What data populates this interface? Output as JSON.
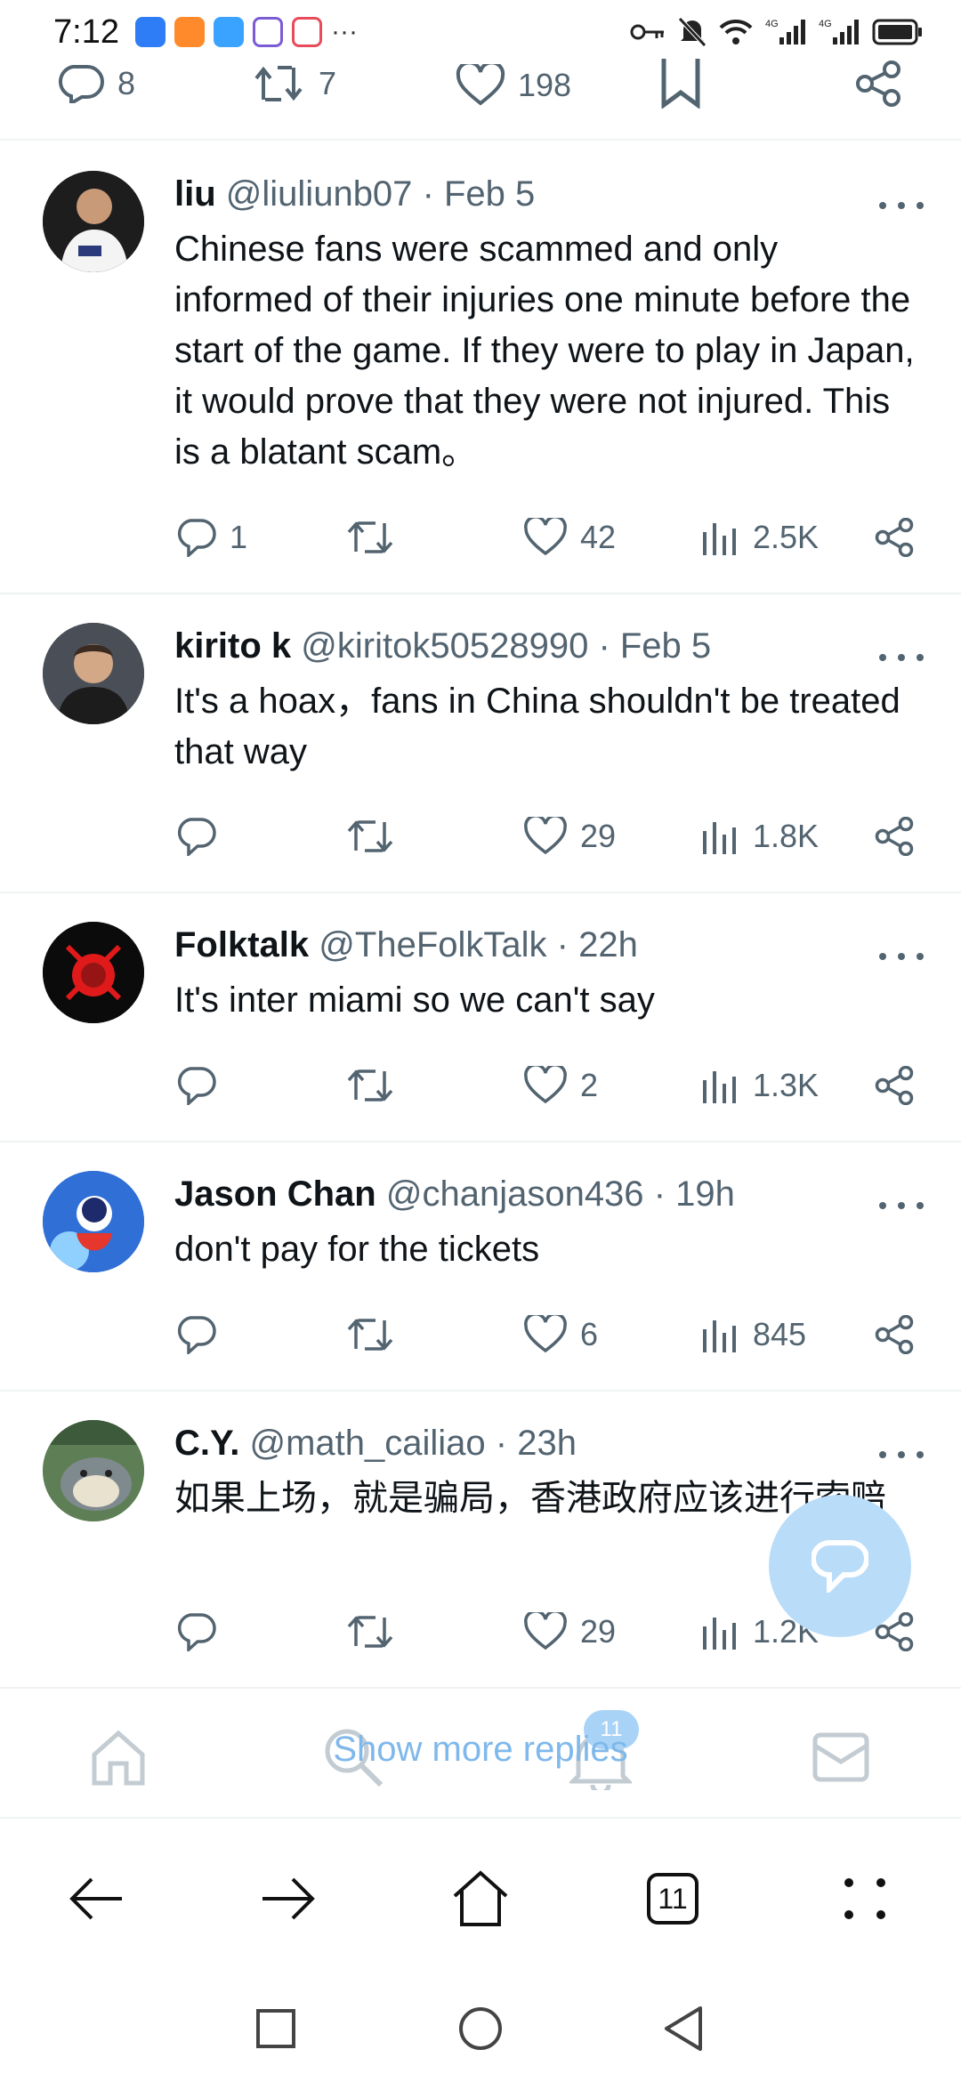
{
  "status_bar": {
    "time": "7:12",
    "more_indicator": "···"
  },
  "top_actions": {
    "replies": "8",
    "reposts": "7",
    "likes": "198"
  },
  "tweets": [
    {
      "name": "liu",
      "handle": "@liuliunb07",
      "time": "· Feb 5",
      "text": "Chinese fans were scammed and only informed of their injuries one minute before the start of the game. If they were to play in Japan, it would prove that they were not injured. This is a blatant scam。",
      "replies": "1",
      "reposts": "",
      "likes": "42",
      "views": "2.5K"
    },
    {
      "name": "kirito k",
      "handle": "@kiritok50528990",
      "time": "· Feb 5",
      "text": "It's a hoax，fans in China shouldn't be treated that way",
      "replies": "",
      "reposts": "",
      "likes": "29",
      "views": "1.8K"
    },
    {
      "name": "Folktalk",
      "handle": "@TheFolkTalk",
      "time": "· 22h",
      "text": "It's inter miami so we can't say",
      "replies": "",
      "reposts": "",
      "likes": "2",
      "views": "1.3K"
    },
    {
      "name": "Jason Chan",
      "handle": "@chanjason436",
      "time": "· 19h",
      "text": "don't pay for the tickets",
      "replies": "",
      "reposts": "",
      "likes": "6",
      "views": "845"
    },
    {
      "name": "C.Y.",
      "handle": "@math_cailiao",
      "time": "· 23h",
      "text": "如果上场，就是骗局，香港政府应该进行索赔",
      "replies": "",
      "reposts": "",
      "likes": "29",
      "views": "1.2K"
    }
  ],
  "x_nav": {
    "show_more": "Show more replies",
    "notification_badge": "11"
  },
  "browser_bar": {
    "tab_count": "11"
  },
  "colors": {
    "accent": "#1d9bf0",
    "muted": "#536471",
    "divider": "#eff3f4"
  }
}
